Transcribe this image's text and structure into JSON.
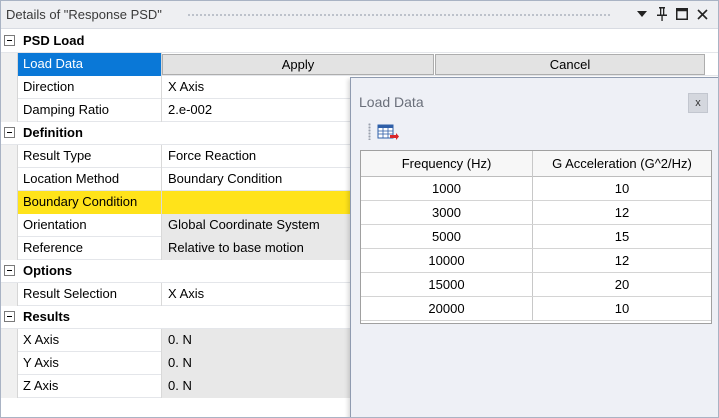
{
  "title": "Details of \"Response PSD\"",
  "title_icons": [
    "dropdown-arrow-icon",
    "pin-icon",
    "maximize-icon",
    "close-icon"
  ],
  "sections": {
    "psd_load": {
      "title": "PSD Load",
      "load_data_label": "Load Data",
      "apply_label": "Apply",
      "cancel_label": "Cancel",
      "direction_label": "Direction",
      "direction_value": "X Axis",
      "damping_label": "Damping Ratio",
      "damping_value": "2.e-002"
    },
    "definition": {
      "title": "Definition",
      "result_type_label": "Result Type",
      "result_type_value": "Force Reaction",
      "location_method_label": "Location Method",
      "location_method_value": "Boundary Condition",
      "boundary_condition_label": "Boundary Condition",
      "boundary_condition_value": "",
      "orientation_label": "Orientation",
      "orientation_value": "Global Coordinate System",
      "reference_label": "Reference",
      "reference_value": "Relative to base motion"
    },
    "options": {
      "title": "Options",
      "result_selection_label": "Result Selection",
      "result_selection_value": "X Axis"
    },
    "results": {
      "title": "Results",
      "x_label": "X Axis",
      "x_value": "0. N",
      "y_label": "Y Axis",
      "y_value": "0. N",
      "z_label": "Z Axis",
      "z_value": "0. N"
    }
  },
  "load_data_popup": {
    "title": "Load Data",
    "close_label": "x",
    "columns": [
      "Frequency (Hz)",
      "G Acceleration (G^2/Hz)"
    ],
    "rows": [
      [
        "1000",
        "10"
      ],
      [
        "3000",
        "12"
      ],
      [
        "5000",
        "15"
      ],
      [
        "10000",
        "12"
      ],
      [
        "15000",
        "20"
      ],
      [
        "20000",
        "10"
      ]
    ]
  },
  "colors": {
    "selection": "#0a78d7",
    "highlight_yellow": "#ffe31a",
    "title_bar": "#eeeff2"
  }
}
